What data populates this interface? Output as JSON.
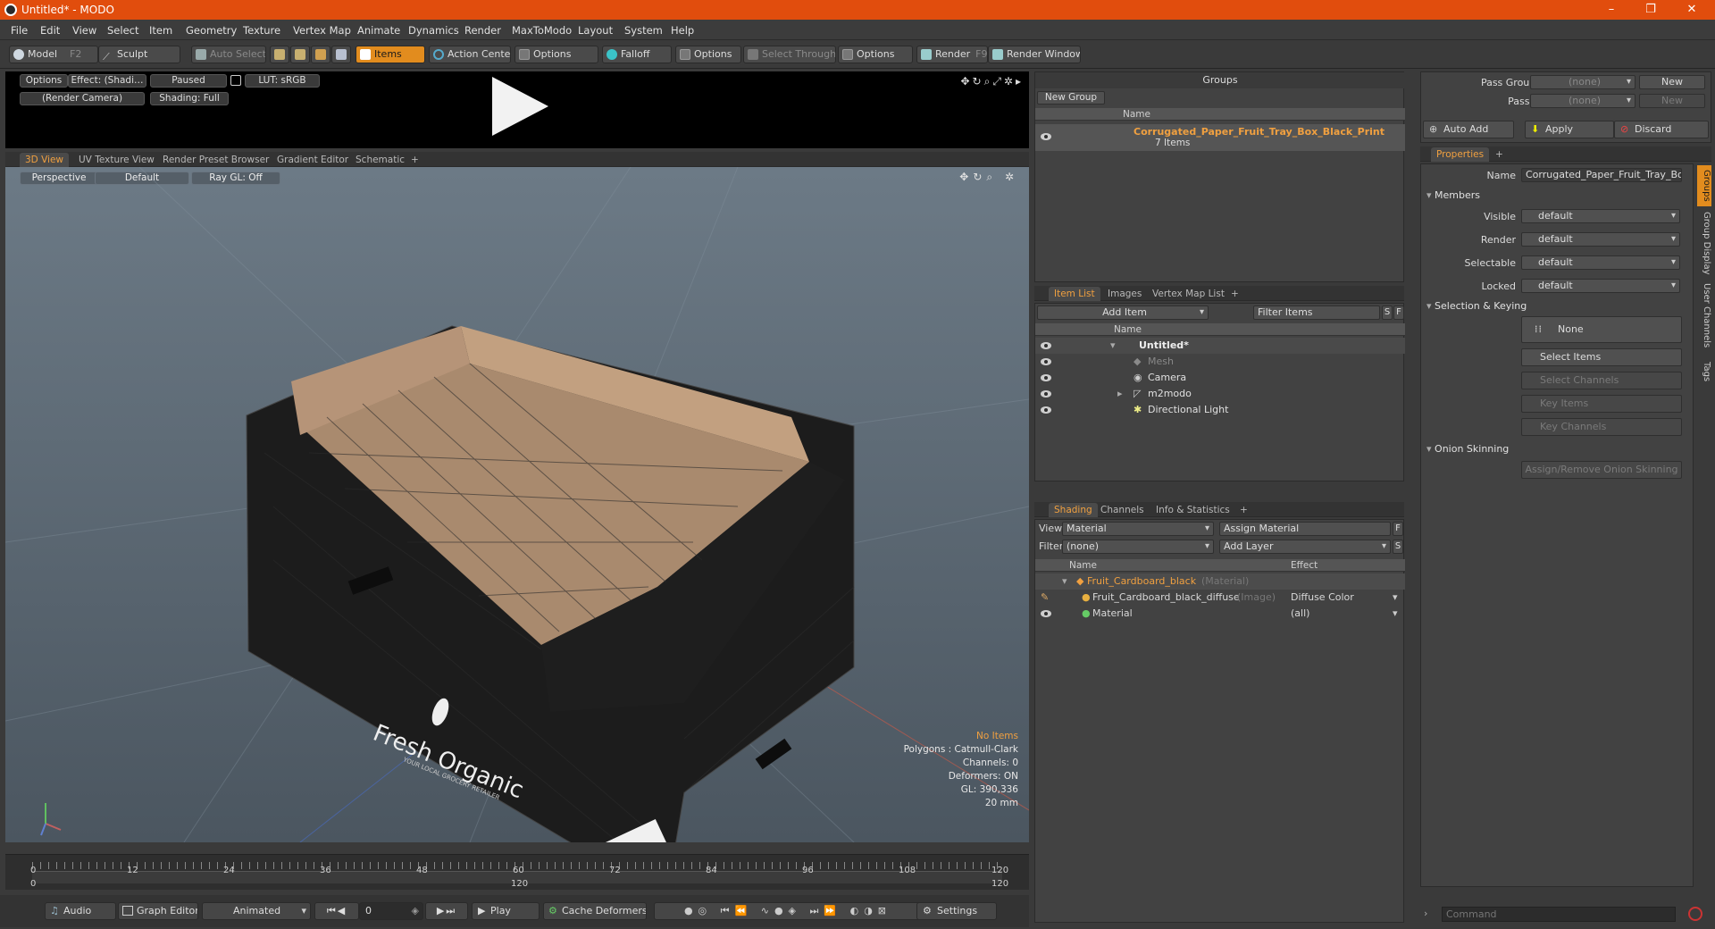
{
  "window": {
    "title": "Untitled* - MODO",
    "minimize": "–",
    "maximize": "❐",
    "close": "✕"
  },
  "menu": [
    "File",
    "Edit",
    "View",
    "Select",
    "Item",
    "Geometry",
    "Texture",
    "Vertex Map",
    "Animate",
    "Dynamics",
    "Render",
    "MaxToModo",
    "Layout",
    "System",
    "Help"
  ],
  "toolbar": {
    "model": "Model",
    "model_key": "F2",
    "sculpt": "Sculpt",
    "auto_select": "Auto Select",
    "items": "Items",
    "action_center": "Action Center",
    "options1": "Options",
    "falloff": "Falloff",
    "options2": "Options",
    "select_through": "Select Through",
    "options3": "Options",
    "render": "Render",
    "render_key": "F9",
    "render_window": "Render Window"
  },
  "preview": {
    "options": "Options",
    "effect": "Effect: (Shadi…",
    "paused": "Paused",
    "lut": "LUT: sRGB",
    "camera": "(Render Camera)",
    "shading": "Shading: Full"
  },
  "viewport_tabs": [
    "3D View",
    "UV Texture View",
    "Render Preset Browser",
    "Gradient Editor",
    "Schematic",
    "+"
  ],
  "viewport": {
    "perspective": "Perspective",
    "default": "Default",
    "raygl": "Ray GL: Off",
    "hud": {
      "no_items": "No Items",
      "polygons": "Polygons : Catmull-Clark",
      "channels": "Channels: 0",
      "deformers": "Deformers: ON",
      "gl": "GL: 390,336",
      "scale": "20 mm"
    },
    "box_text": {
      "brand": "Fresh Organic",
      "tagline": "YOUR LOCAL GROCERY RETAILER"
    }
  },
  "timeline": {
    "ticks": [
      "0",
      "12",
      "24",
      "36",
      "48",
      "60",
      "72",
      "84",
      "96",
      "108",
      "120"
    ],
    "start": "0",
    "mid": "120",
    "end": "120"
  },
  "transport": {
    "audio": "Audio",
    "graph_editor": "Graph Editor",
    "animated": "Animated",
    "frame": "0",
    "play": "Play",
    "cache_deformers": "Cache Deformers",
    "settings": "Settings"
  },
  "groups": {
    "title": "Groups",
    "new_group": "New Group",
    "name_col": "Name",
    "item_name": "Corrugated_Paper_Fruit_Tray_Box_Black_Print",
    "item_count": "7 Items"
  },
  "item_list": {
    "tabs": [
      "Item List",
      "Images",
      "Vertex Map List",
      "+"
    ],
    "add_item": "Add Item",
    "filter": "Filter Items",
    "s": "S",
    "f": "F",
    "name_col": "Name",
    "items": [
      {
        "name": "Untitled*",
        "indent": 0,
        "bold": true
      },
      {
        "name": "Mesh",
        "indent": 1,
        "dim": true
      },
      {
        "name": "Camera",
        "indent": 1
      },
      {
        "name": "m2modo",
        "indent": 1
      },
      {
        "name": "Directional Light",
        "indent": 1
      }
    ]
  },
  "shading": {
    "tabs": [
      "Shading",
      "Channels",
      "Info & Statistics",
      "+"
    ],
    "view_label": "View",
    "view_value": "Material",
    "assign_material": "Assign Material",
    "f": "F",
    "filter_label": "Filter",
    "filter_value": "(none)",
    "add_layer": "Add Layer",
    "s": "S",
    "col_name": "Name",
    "col_effect": "Effect",
    "rows": [
      {
        "name": "Fruit_Cardboard_black",
        "tag": "(Material)",
        "effect": ""
      },
      {
        "name": "Fruit_Cardboard_black_diffuse",
        "tag": "(Image)",
        "effect": "Diffuse Color"
      },
      {
        "name": "Material",
        "tag": "",
        "effect": "(all)"
      }
    ]
  },
  "passes": {
    "pass_groups_label": "Pass Groups",
    "pass_groups_value": "(none)",
    "new": "New",
    "passes_label": "Passes",
    "passes_value": "(none)",
    "new2": "New",
    "auto_add": "Auto Add",
    "apply": "Apply",
    "discard": "Discard"
  },
  "properties": {
    "tab": "Properties",
    "plus": "+",
    "name_label": "Name",
    "name_value": "Corrugated_Paper_Fruit_Tray_Box_",
    "members": "Members",
    "fields": [
      {
        "label": "Visible",
        "value": "default"
      },
      {
        "label": "Render",
        "value": "default"
      },
      {
        "label": "Selectable",
        "value": "default"
      },
      {
        "label": "Locked",
        "value": "default"
      }
    ],
    "selection_keying": "Selection & Keying",
    "none": "None",
    "select_items": "Select Items",
    "select_channels": "Select Channels",
    "key_items": "Key Items",
    "key_channels": "Key Channels",
    "onion": "Onion Skinning",
    "assign_onion": "Assign/Remove Onion Skinning",
    "side_tabs": [
      "Groups",
      "Group Display",
      "User Channels",
      "Tags"
    ],
    "command_placeholder": "Command"
  }
}
